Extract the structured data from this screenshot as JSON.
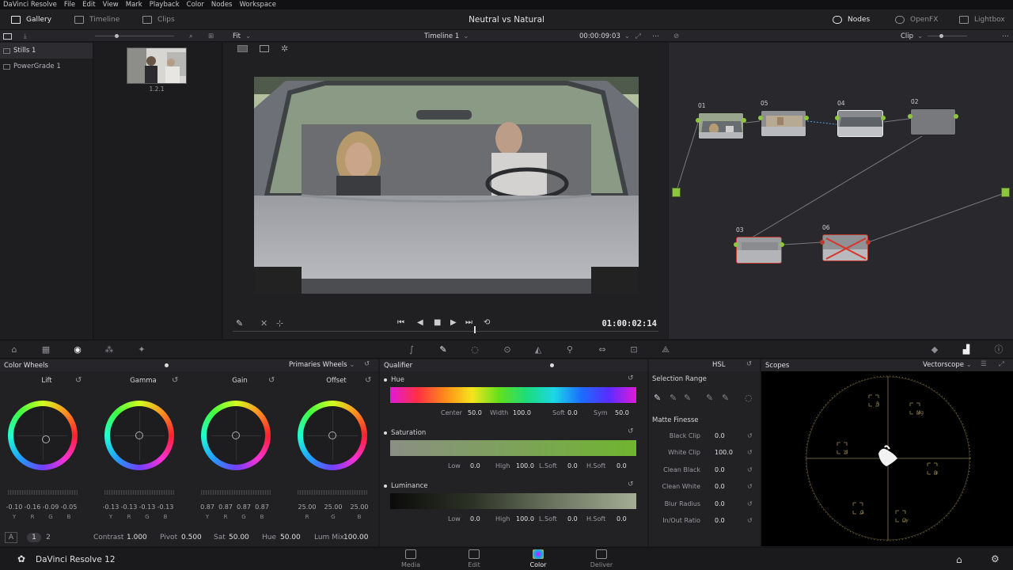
{
  "menu": [
    "DaVinci Resolve",
    "File",
    "Edit",
    "View",
    "Mark",
    "Playback",
    "Color",
    "Nodes",
    "Workspace"
  ],
  "toolbar": {
    "gallery": "Gallery",
    "timeline": "Timeline",
    "clips": "Clips",
    "project_title": "Neutral vs Natural",
    "nodes": "Nodes",
    "openfx": "OpenFX",
    "lightbox": "Lightbox"
  },
  "subbar": {
    "fit": "Fit",
    "timeline_name": "Timeline 1",
    "timecode": "00:00:09:03",
    "clip_mode": "Clip"
  },
  "gallery": {
    "albums": [
      "Stills 1",
      "PowerGrade 1"
    ],
    "still_label": "1.2.1"
  },
  "viewer": {
    "timecode": "01:00:02:14"
  },
  "nodes": {
    "labels": [
      "01",
      "05",
      "04",
      "02",
      "03",
      "06"
    ]
  },
  "panels": {
    "color_wheels": "Color Wheels",
    "primaries_mode": "Primaries Wheels",
    "qualifier": "Qualifier",
    "qualifier_mode": "HSL",
    "scopes": "Scopes",
    "scope_mode": "Vectorscope"
  },
  "wheels": [
    {
      "name": "Lift",
      "values": [
        "-0.10",
        "-0.16",
        "-0.09",
        "-0.05"
      ],
      "labels": [
        "Y",
        "R",
        "G",
        "B"
      ]
    },
    {
      "name": "Gamma",
      "values": [
        "-0.13",
        "-0.13",
        "-0.13",
        "-0.13"
      ],
      "labels": [
        "Y",
        "R",
        "G",
        "B"
      ]
    },
    {
      "name": "Gain",
      "values": [
        "0.87",
        "0.87",
        "0.87",
        "0.87"
      ],
      "labels": [
        "Y",
        "R",
        "G",
        "B"
      ]
    },
    {
      "name": "Offset",
      "values": [
        "25.00",
        "25.00",
        "25.00"
      ],
      "labels": [
        "R",
        "G",
        "B"
      ]
    }
  ],
  "wheel_footer": {
    "mode_a": "A",
    "page1": "1",
    "page2": "2",
    "contrast_label": "Contrast",
    "contrast": "1.000",
    "pivot_label": "Pivot",
    "pivot": "0.500",
    "sat_label": "Sat",
    "sat": "50.00",
    "hue_label": "Hue",
    "hue": "50.00",
    "lummix_label": "Lum Mix",
    "lummix": "100.00"
  },
  "qualifier": {
    "hue": {
      "title": "Hue",
      "center_label": "Center",
      "center": "50.0",
      "width_label": "Width",
      "width": "100.0",
      "soft_label": "Soft",
      "soft": "0.0",
      "sym_label": "Sym",
      "sym": "50.0"
    },
    "saturation": {
      "title": "Saturation",
      "low_label": "Low",
      "low": "0.0",
      "high_label": "High",
      "high": "100.0",
      "lsoft_label": "L.Soft",
      "lsoft": "0.0",
      "hsoft_label": "H.Soft",
      "hsoft": "0.0"
    },
    "luminance": {
      "title": "Luminance",
      "low_label": "Low",
      "low": "0.0",
      "high_label": "High",
      "high": "100.0",
      "lsoft_label": "L.Soft",
      "lsoft": "0.0",
      "hsoft_label": "H.Soft",
      "hsoft": "0.0"
    }
  },
  "selection_range": {
    "title": "Selection Range",
    "matte_finesse": "Matte Finesse",
    "rows": [
      {
        "label": "Black Clip",
        "value": "0.0"
      },
      {
        "label": "White Clip",
        "value": "100.0"
      },
      {
        "label": "Clean Black",
        "value": "0.0"
      },
      {
        "label": "Clean White",
        "value": "0.0"
      },
      {
        "label": "Blur Radius",
        "value": "0.0"
      },
      {
        "label": "In/Out Ratio",
        "value": "0.0"
      }
    ]
  },
  "vectorscope_targets": [
    "R",
    "Mg",
    "Yl",
    "B",
    "G",
    "Cy"
  ],
  "bottom": {
    "app_name": "DaVinci Resolve 12",
    "pages": [
      "Media",
      "Edit",
      "Color",
      "Deliver"
    ],
    "active_page": "Color"
  },
  "colors": {
    "accent_green": "#8dc63f",
    "node_border_red": "#c0392b",
    "scope_graticule": "#a08a50"
  }
}
